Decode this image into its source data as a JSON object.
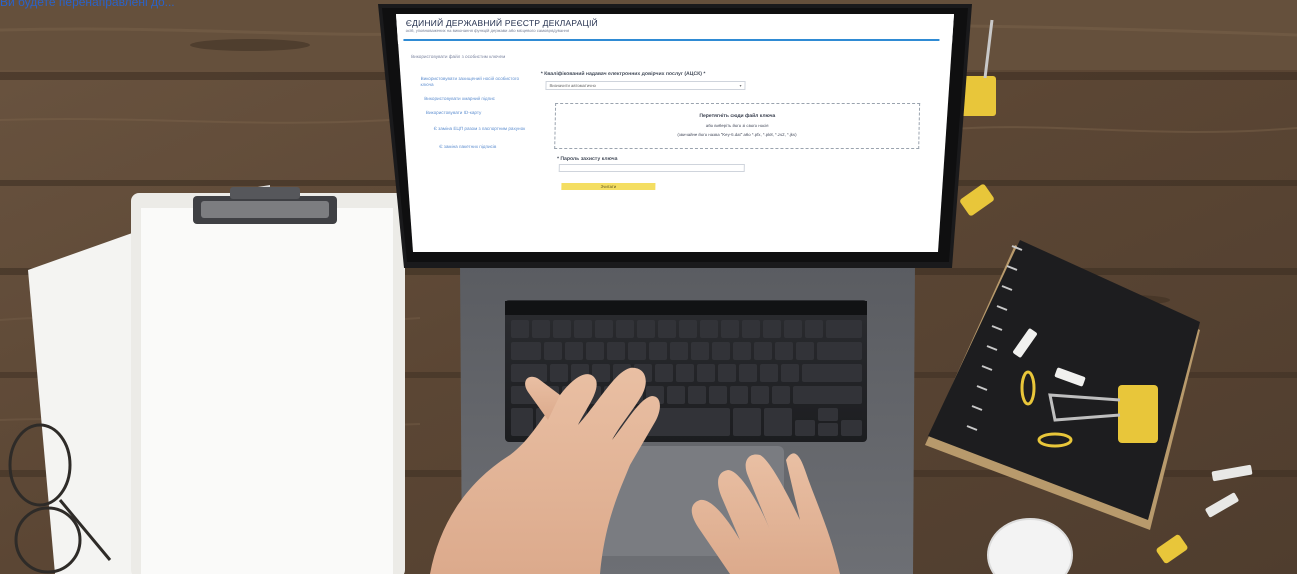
{
  "overlay": {
    "link_text": "Ви будете перенаправлені до..."
  },
  "screen": {
    "header": {
      "title": "ЄДИНИЙ ДЕРЖАВНИЙ РЕЄСТР ДЕКЛАРАЦІЙ",
      "subtitle": "осіб, уповноважених на виконання функцій держави або місцевого самоврядування"
    },
    "sidebar": {
      "heading": "Використовувати файл з особистим ключем",
      "items": [
        "Використовувати захищений носій особистого ключа",
        "Використовувати хмарний підпис",
        "Використовувати ID-карту",
        "Є заміна ЕЦП разом з паспортним рахунок",
        "Є заміна пакетних підписів"
      ]
    },
    "form": {
      "acsk_label": "* Кваліфікований надавач електронних довірчих послуг (АЦСК) *",
      "acsk_value": "Визначити автоматично",
      "drop_title": "Перетягніть сюди файл ключа",
      "drop_hint": "або виберіть його зі свого носія",
      "drop_formats": "(звичайне його назва \"Key-6.dat\" або *.pfx, *.pk8, *.zs2, *.jks)",
      "password_label": "* Пароль захисту ключа",
      "read_button": "Зчитати"
    }
  },
  "colors": {
    "wood": "#5e4a37",
    "screen_bg": "#ffffff",
    "accent_line": "#2f8bd4",
    "button_yellow": "#f4de62",
    "binder_clip": "#e8c63a"
  }
}
